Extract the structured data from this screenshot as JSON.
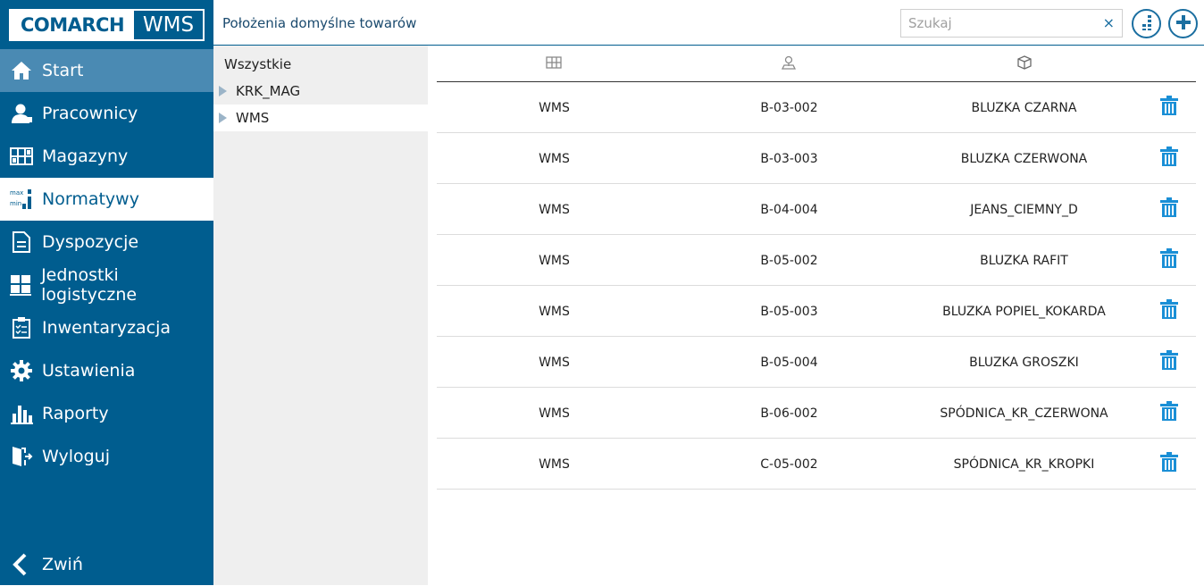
{
  "app": {
    "logo_brand": "COMARCH",
    "logo_product": "WMS"
  },
  "sidebar": {
    "items": [
      {
        "label": "Start",
        "icon": "home-icon"
      },
      {
        "label": "Pracownicy",
        "icon": "user-icon"
      },
      {
        "label": "Magazyny",
        "icon": "warehouse-icon"
      },
      {
        "label": "Normatywy",
        "icon": "min-max-icon"
      },
      {
        "label": "Dyspozycje",
        "icon": "document-icon"
      },
      {
        "label": "Jednostki logistyczne",
        "icon": "pallet-icon"
      },
      {
        "label": "Inwentaryzacja",
        "icon": "clipboard-icon"
      },
      {
        "label": "Ustawienia",
        "icon": "gear-icon"
      },
      {
        "label": "Raporty",
        "icon": "bar-chart-icon"
      },
      {
        "label": "Wyloguj",
        "icon": "logout-icon"
      }
    ],
    "collapse_label": "Zwiń"
  },
  "header": {
    "title": "Położenia domyślne towarów",
    "search_placeholder": "Szukaj",
    "clear_glyph": "×"
  },
  "tree": {
    "all_label": "Wszystkie",
    "nodes": [
      {
        "label": "KRK_MAG"
      },
      {
        "label": "WMS"
      }
    ]
  },
  "table": {
    "column_icons": [
      "warehouse-icon",
      "location-icon",
      "product-box-icon"
    ],
    "rows": [
      {
        "warehouse": "WMS",
        "location": "B-03-002",
        "product": "BLUZKA CZARNA"
      },
      {
        "warehouse": "WMS",
        "location": "B-03-003",
        "product": "BLUZKA CZERWONA"
      },
      {
        "warehouse": "WMS",
        "location": "B-04-004",
        "product": "JEANS_CIEMNY_D"
      },
      {
        "warehouse": "WMS",
        "location": "B-05-002",
        "product": "BLUZKA RAFIT"
      },
      {
        "warehouse": "WMS",
        "location": "B-05-003",
        "product": "BLUZKA POPIEL_KOKARDA"
      },
      {
        "warehouse": "WMS",
        "location": "B-05-004",
        "product": "BLUZKA GROSZKI"
      },
      {
        "warehouse": "WMS",
        "location": "B-06-002",
        "product": "SPÓDNICA_KR_CZERWONA"
      },
      {
        "warehouse": "WMS",
        "location": "C-05-002",
        "product": "SPÓDNICA_KR_KROPKI"
      }
    ]
  },
  "colors": {
    "sidebar_bg": "#005d8f",
    "sidebar_hover": "#4a8ab3",
    "accent": "#1a8fd6"
  }
}
